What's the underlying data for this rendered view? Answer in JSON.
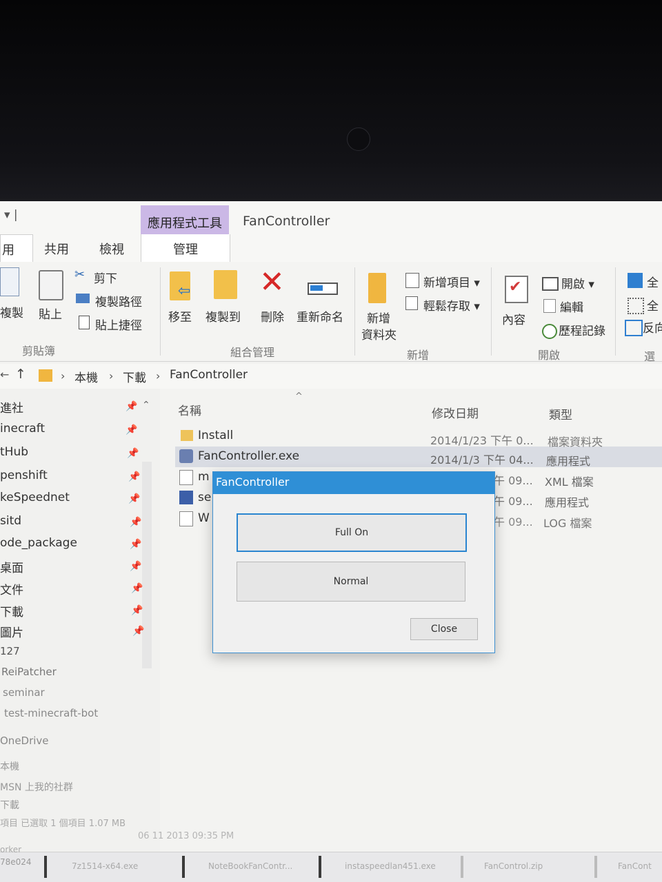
{
  "window": {
    "quick_access": "▾ |",
    "context_tab_group": "應用程式工具",
    "title": "FanController"
  },
  "tabs": [
    {
      "label": "用"
    },
    {
      "label": "共用"
    },
    {
      "label": "檢視"
    },
    {
      "label": "管理"
    }
  ],
  "ribbon": {
    "clipboard": {
      "copy": "複製",
      "paste": "貼上",
      "cut": "剪下",
      "copy_path": "複製路徑",
      "paste_shortcut": "貼上捷徑",
      "group": "剪貼簿"
    },
    "organize": {
      "move_to": "移至",
      "copy_to": "複製到",
      "delete": "刪除",
      "rename": "重新命名",
      "group": "組合管理"
    },
    "new": {
      "new_folder_line1": "新增",
      "new_folder_line2": "資料夾",
      "new_item": "新增項目 ▾",
      "easy_access": "輕鬆存取 ▾",
      "group": "新增"
    },
    "open": {
      "properties": "內容",
      "open": "開啟 ▾",
      "edit": "編輯",
      "history": "歷程記錄",
      "group": "開啟"
    },
    "select": {
      "select_all": "全",
      "select_none": "全",
      "invert": "反向",
      "group": "選"
    }
  },
  "address": {
    "segments": [
      "本機",
      "下載",
      "FanController"
    ]
  },
  "nav": {
    "items": [
      "進社",
      "inecraft",
      "tHub",
      "penshift",
      "keSpeednet",
      "sitd",
      "ode_package",
      "桌面",
      "文件",
      "下載",
      "圖片",
      "127",
      "ReiPatcher",
      "seminar",
      "test-minecraft-bot",
      "OneDrive",
      "本機",
      "MSN 上我的社群",
      "下載"
    ]
  },
  "columns": {
    "name": "名稱",
    "date": "修改日期",
    "type": "類型"
  },
  "files": [
    {
      "name": "Install",
      "date": "2014/1/23 下午 0...",
      "type": "檔案資料夾"
    },
    {
      "name": "FanController.exe",
      "date": "2014/1/3 下午 04...",
      "type": "應用程式"
    },
    {
      "name": "m",
      "date": "午 09...",
      "type": "XML 檔案"
    },
    {
      "name": "se",
      "date": "午 09...",
      "type": "應用程式"
    },
    {
      "name": "W",
      "date": "午 09...",
      "type": "LOG 檔案"
    }
  ],
  "status": {
    "text": "項目  已選取 1 個項目 1.07 MB",
    "date_line": "06 11 2013 09:35 PM"
  },
  "taskbar": [
    "orker",
    "78e024",
    "7z1514-x64.exe",
    "NoteBookFanContr...",
    "instaspeedlan451.exe",
    "FanControl.zip",
    "FanCont"
  ],
  "dialog": {
    "title": "FanController",
    "full_on": "Full On",
    "normal": "Normal",
    "close": "Close"
  }
}
